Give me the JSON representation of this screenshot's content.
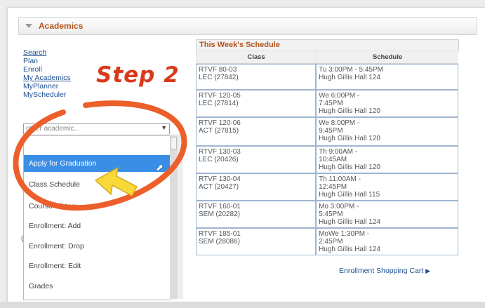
{
  "section": {
    "title": "Academics"
  },
  "nav": {
    "links": [
      "Search",
      "Plan",
      "Enroll",
      "My Academics",
      "MyPlanner",
      "MyScheduler"
    ]
  },
  "dropdown": {
    "selected": "other academic...",
    "options": [
      "Apply for Graduation",
      "Class Schedule",
      "Course History",
      "Enrollment: Add",
      "Enrollment: Drop",
      "Enrollment: Edit",
      "Grades"
    ],
    "highlighted": "Apply for Graduation"
  },
  "annotation": {
    "step_label": "Step 2",
    "color": "#e0502a"
  },
  "schedule": {
    "title": "This Week's Schedule",
    "columns": [
      "Class",
      "Schedule"
    ],
    "rows": [
      {
        "class": [
          "RTVF 80-03",
          "LEC (27842)"
        ],
        "schedule": [
          "Tu 3:00PM - 5:45PM",
          "Hugh Gillis Hall 124"
        ]
      },
      {
        "class": [
          "RTVF 120-05",
          "LEC (27814)"
        ],
        "schedule": [
          "We 6:00PM -",
          "7:45PM",
          "Hugh Gillis Hall 120"
        ]
      },
      {
        "class": [
          "RTVF 120-06",
          "ACT (27815)"
        ],
        "schedule": [
          "We 8:00PM -",
          "9:45PM",
          "Hugh Gillis Hall 120"
        ]
      },
      {
        "class": [
          "RTVF 130-03",
          "LEC (20426)"
        ],
        "schedule": [
          "Th 9:00AM -",
          "10:45AM",
          "Hugh Gillis Hall 120"
        ]
      },
      {
        "class": [
          "RTVF 130-04",
          "ACT (20427)"
        ],
        "schedule": [
          "Th 11:00AM -",
          "12:45PM",
          "Hugh Gillis Hall 115"
        ]
      },
      {
        "class": [
          "RTVF 160-01",
          "SEM (20282)"
        ],
        "schedule": [
          "Mo 3:00PM -",
          "5:45PM",
          "Hugh Gillis Hall 124"
        ]
      },
      {
        "class": [
          "RTVF 185-01",
          "SEM (28086)"
        ],
        "schedule": [
          "MoWe 1:30PM -",
          "2:45PM",
          "Hugh Gillis Hall 124"
        ]
      }
    ],
    "cart_link": "Enrollment Shopping Cart"
  }
}
